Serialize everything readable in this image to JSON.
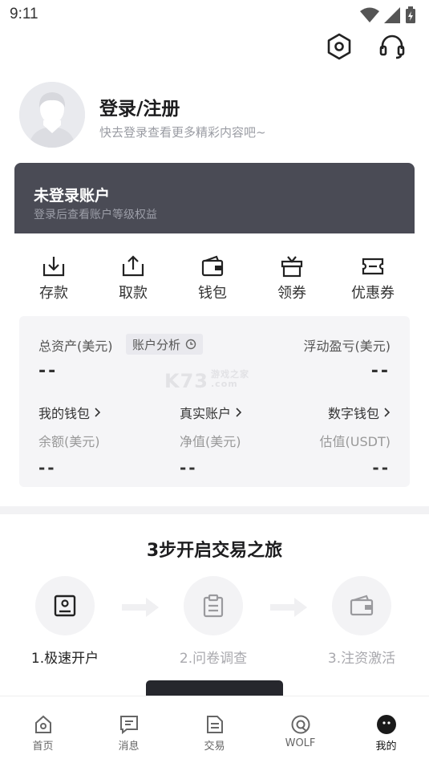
{
  "status_bar": {
    "time": "9:11"
  },
  "header": {
    "icons": [
      "settings-hexagon-icon",
      "headset-icon"
    ]
  },
  "profile": {
    "title": "登录/注册",
    "subtitle": "快去登录查看更多精彩内容吧~"
  },
  "account_card": {
    "title": "未登录账户",
    "subtitle": "登录后查看账户等级权益"
  },
  "quick_actions": [
    {
      "label": "存款",
      "icon": "deposit-icon"
    },
    {
      "label": "取款",
      "icon": "withdraw-icon"
    },
    {
      "label": "钱包",
      "icon": "wallet-icon"
    },
    {
      "label": "领券",
      "icon": "gift-icon"
    },
    {
      "label": "优惠券",
      "icon": "coupon-icon"
    }
  ],
  "assets": {
    "total_label": "总资产(美元)",
    "analysis_label": "账户分析",
    "floating_label": "浮动盈亏(美元)",
    "total_value": "--",
    "floating_value": "--",
    "wallets": [
      {
        "name": "我的钱包",
        "sub": "余额(美元)",
        "value": "--"
      },
      {
        "name": "真实账户",
        "sub": "净值(美元)",
        "value": "--"
      },
      {
        "name": "数字钱包",
        "sub": "估值(USDT)",
        "value": "--"
      }
    ]
  },
  "watermark": {
    "text": "K73",
    "small_top": "游戏之家",
    "small_bottom": ".com"
  },
  "steps": {
    "title": "3步开启交易之旅",
    "items": [
      {
        "label": "1.极速开户",
        "icon": "id-card-icon"
      },
      {
        "label": "2.问卷调查",
        "icon": "clipboard-icon"
      },
      {
        "label": "3.注资激活",
        "icon": "wallet-icon"
      }
    ]
  },
  "tabbar": {
    "items": [
      {
        "label": "首页",
        "icon": "home-icon"
      },
      {
        "label": "消息",
        "icon": "message-icon"
      },
      {
        "label": "交易",
        "icon": "trade-icon"
      },
      {
        "label": "WOLF",
        "icon": "wolf-icon"
      },
      {
        "label": "我的",
        "icon": "profile-icon"
      }
    ],
    "active_index": 4
  },
  "colors": {
    "card_dark": "#4a4b55",
    "button_dark": "#26272d",
    "panel_grey": "#f5f5f7"
  }
}
